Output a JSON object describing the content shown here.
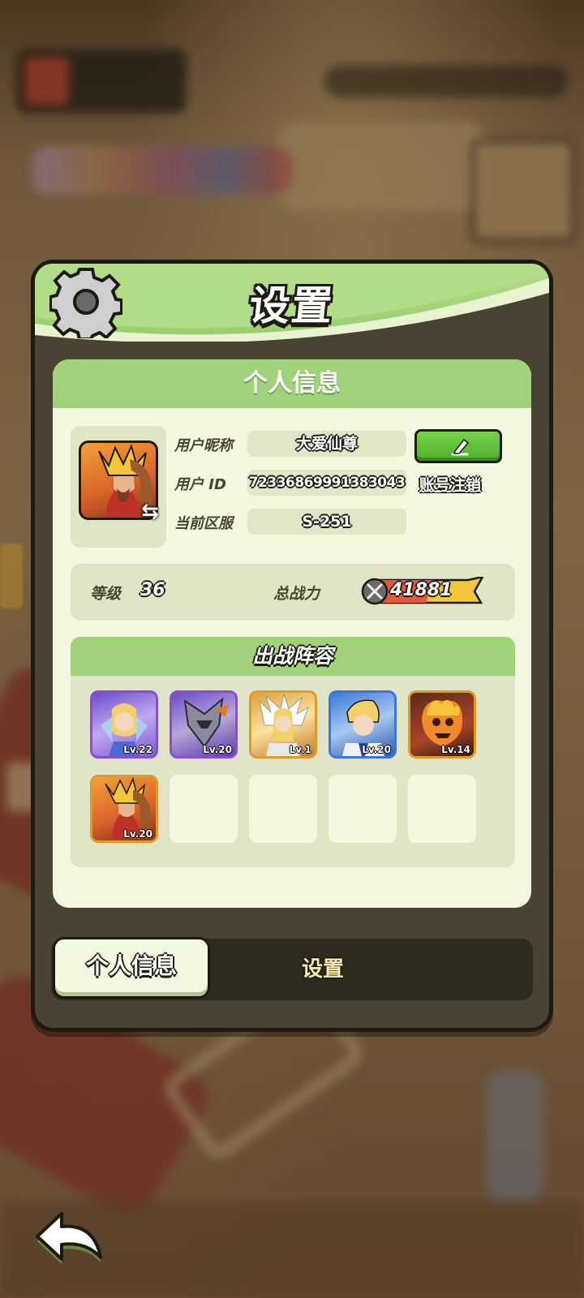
{
  "panel": {
    "title": "设置",
    "section_title": "个人信息"
  },
  "profile": {
    "nickname_label": "用户昵称",
    "nickname": "大爱仙尊",
    "id_label": "用户  ID",
    "user_id": "7233686999138​3043",
    "server_label": "当前区服",
    "server": "S-251",
    "logout_label": "账号注销"
  },
  "stats": {
    "level_label": "等级",
    "level": "36",
    "power_label": "总战力",
    "power": "41881"
  },
  "lineup": {
    "title": "出战阵容",
    "heroes": [
      {
        "level": "Lv.22",
        "rarity": "purple"
      },
      {
        "level": "Lv.20",
        "rarity": "purple"
      },
      {
        "level": "Lv.1",
        "rarity": "gold"
      },
      {
        "level": "Lv.20",
        "rarity": "blue"
      },
      {
        "level": "Lv.14",
        "rarity": "gold"
      },
      {
        "level": "Lv.20",
        "rarity": "gold"
      }
    ],
    "empty_slots": 4
  },
  "tabs": {
    "active": "个人信息",
    "inactive": "设置"
  },
  "colors": {
    "panel_green": "#9fd27a",
    "card_bg": "#f3f8e0",
    "button_green": "#4fb12d"
  },
  "icons": [
    "gear-icon",
    "swap-icon",
    "pencil-icon",
    "sword-icon",
    "back-arrow-icon"
  ]
}
